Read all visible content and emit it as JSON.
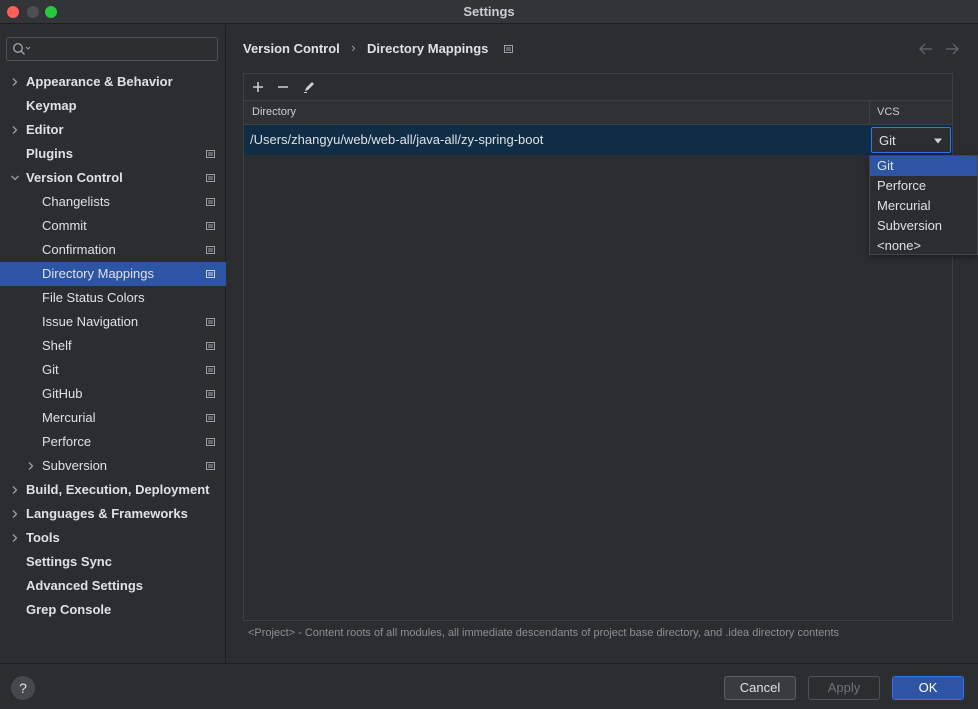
{
  "window": {
    "title": "Settings"
  },
  "search": {
    "placeholder": ""
  },
  "sidebar": {
    "items": [
      {
        "label": "Appearance & Behavior",
        "level": 0,
        "bold": true,
        "chevron": true,
        "proj": false,
        "selected": false
      },
      {
        "label": "Keymap",
        "level": 0,
        "bold": true,
        "chevron": false,
        "proj": false,
        "selected": false
      },
      {
        "label": "Editor",
        "level": 0,
        "bold": true,
        "chevron": true,
        "proj": false,
        "selected": false
      },
      {
        "label": "Plugins",
        "level": 0,
        "bold": true,
        "chevron": false,
        "proj": true,
        "selected": false
      },
      {
        "label": "Version Control",
        "level": 0,
        "bold": true,
        "chevron": "open",
        "proj": true,
        "selected": false
      },
      {
        "label": "Changelists",
        "level": 1,
        "bold": false,
        "chevron": false,
        "proj": true,
        "selected": false
      },
      {
        "label": "Commit",
        "level": 1,
        "bold": false,
        "chevron": false,
        "proj": true,
        "selected": false
      },
      {
        "label": "Confirmation",
        "level": 1,
        "bold": false,
        "chevron": false,
        "proj": true,
        "selected": false
      },
      {
        "label": "Directory Mappings",
        "level": 1,
        "bold": false,
        "chevron": false,
        "proj": true,
        "selected": true
      },
      {
        "label": "File Status Colors",
        "level": 1,
        "bold": false,
        "chevron": false,
        "proj": false,
        "selected": false
      },
      {
        "label": "Issue Navigation",
        "level": 1,
        "bold": false,
        "chevron": false,
        "proj": true,
        "selected": false
      },
      {
        "label": "Shelf",
        "level": 1,
        "bold": false,
        "chevron": false,
        "proj": true,
        "selected": false
      },
      {
        "label": "Git",
        "level": 1,
        "bold": false,
        "chevron": false,
        "proj": true,
        "selected": false
      },
      {
        "label": "GitHub",
        "level": 1,
        "bold": false,
        "chevron": false,
        "proj": true,
        "selected": false
      },
      {
        "label": "Mercurial",
        "level": 1,
        "bold": false,
        "chevron": false,
        "proj": true,
        "selected": false
      },
      {
        "label": "Perforce",
        "level": 1,
        "bold": false,
        "chevron": false,
        "proj": true,
        "selected": false
      },
      {
        "label": "Subversion",
        "level": 1,
        "bold": false,
        "chevron": true,
        "proj": true,
        "selected": false
      },
      {
        "label": "Build, Execution, Deployment",
        "level": 0,
        "bold": true,
        "chevron": true,
        "proj": false,
        "selected": false
      },
      {
        "label": "Languages & Frameworks",
        "level": 0,
        "bold": true,
        "chevron": true,
        "proj": false,
        "selected": false
      },
      {
        "label": "Tools",
        "level": 0,
        "bold": true,
        "chevron": true,
        "proj": false,
        "selected": false
      },
      {
        "label": "Settings Sync",
        "level": 0,
        "bold": true,
        "chevron": false,
        "proj": false,
        "selected": false
      },
      {
        "label": "Advanced Settings",
        "level": 0,
        "bold": true,
        "chevron": false,
        "proj": false,
        "selected": false
      },
      {
        "label": "Grep Console",
        "level": 0,
        "bold": true,
        "chevron": false,
        "proj": false,
        "selected": false
      }
    ]
  },
  "breadcrumb": {
    "parent": "Version Control",
    "separator": "›",
    "current": "Directory Mappings"
  },
  "table": {
    "columns": {
      "directory": "Directory",
      "vcs": "VCS"
    },
    "rows": [
      {
        "directory": "/Users/zhangyu/web/web-all/java-all/zy-spring-boot",
        "vcs": "Git"
      }
    ]
  },
  "vcs_dropdown": {
    "options": [
      "Git",
      "Perforce",
      "Mercurial",
      "Subversion",
      "<none>"
    ],
    "selected_index": 0
  },
  "footnote": "<Project> - Content roots of all modules, all immediate descendants of project base directory, and .idea directory contents",
  "buttons": {
    "help": "?",
    "cancel": "Cancel",
    "apply": "Apply",
    "ok": "OK"
  },
  "icons": {
    "add": "add-icon",
    "remove": "remove-icon",
    "edit": "edit-icon",
    "back": "arrow-left-icon",
    "forward": "arrow-right-icon",
    "project_scope": "project-scope-icon",
    "search": "search-icon"
  },
  "colors": {
    "selection": "#2e55a3",
    "accent": "#3574f0",
    "row_highlight": "#0f2d45"
  }
}
